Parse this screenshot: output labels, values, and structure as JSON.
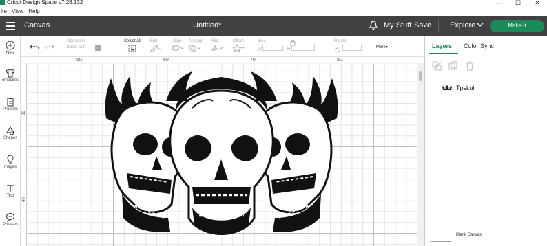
{
  "window": {
    "title": "Cricut Design Space  v7.26.132",
    "minimize": "—",
    "maximize": "☐",
    "close": "✕"
  },
  "menu": [
    "ile",
    "View",
    "Help"
  ],
  "header": {
    "canvas_label": "Canvas",
    "doc_title": "Untitled*",
    "my_stuff": "My Stuff",
    "save": "Save",
    "explore": "Explore",
    "make_it": "Make It"
  },
  "rail": [
    {
      "label": "New",
      "icon": "plus-circle-icon"
    },
    {
      "label": "emplates",
      "icon": "tshirt-icon"
    },
    {
      "label": "Projects",
      "icon": "clipboard-icon"
    },
    {
      "label": "Shapes",
      "icon": "shapes-icon"
    },
    {
      "label": "mages",
      "icon": "lightbulb-icon"
    },
    {
      "label": "Text",
      "icon": "text-icon"
    },
    {
      "label": "Phrases",
      "icon": "speech-bubble-icon"
    }
  ],
  "toolbar": {
    "operation_label": "Operation",
    "operation_value": "Basic Cut",
    "select_all": "Select All",
    "edit": "Edit",
    "align": "Align",
    "arrange": "Arrange",
    "flip": "Flip",
    "offset": "Offset",
    "size": "Size",
    "w": "W",
    "h": "H",
    "rotate": "Rotate",
    "more": "More"
  },
  "rulers": {
    "top": [
      "50",
      "60",
      "70",
      "80"
    ],
    "left": [
      "30",
      "40"
    ]
  },
  "panel": {
    "tab_layers": "Layers",
    "tab_color_sync": "Color Sync",
    "layer_name": "Tpskull",
    "blank_canvas": "Blank Canvas"
  },
  "colors": {
    "accent": "#1a8a5a",
    "header_bg": "#414042"
  }
}
